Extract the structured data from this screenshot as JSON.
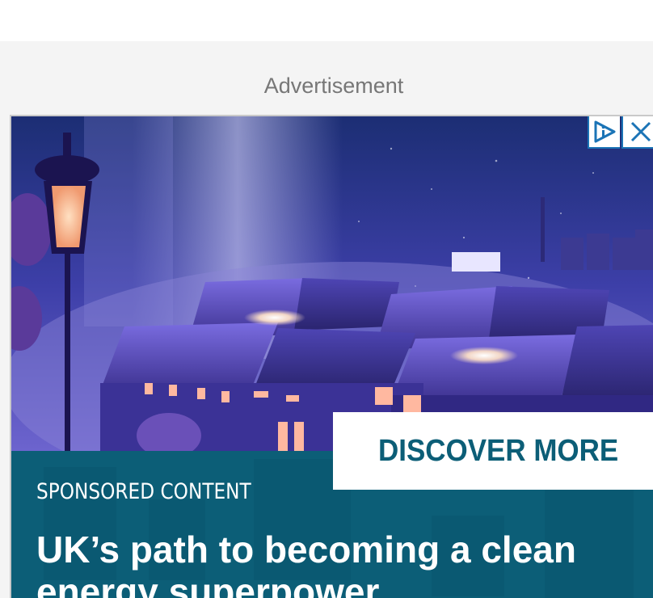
{
  "ad": {
    "label": "Advertisement",
    "sponsored_label": "SPONSORED CONTENT",
    "headline": "UK’s path to becoming a clean energy superpower",
    "cta_label": "DISCOVER MORE"
  },
  "icons": {
    "adchoices": "adchoices-icon",
    "close": "close-icon"
  },
  "colors": {
    "ad_panel": "#0c5e77",
    "cta_text": "#0c5e77",
    "adchoices_blue": "#1b74b6",
    "label_gray": "#777777"
  }
}
